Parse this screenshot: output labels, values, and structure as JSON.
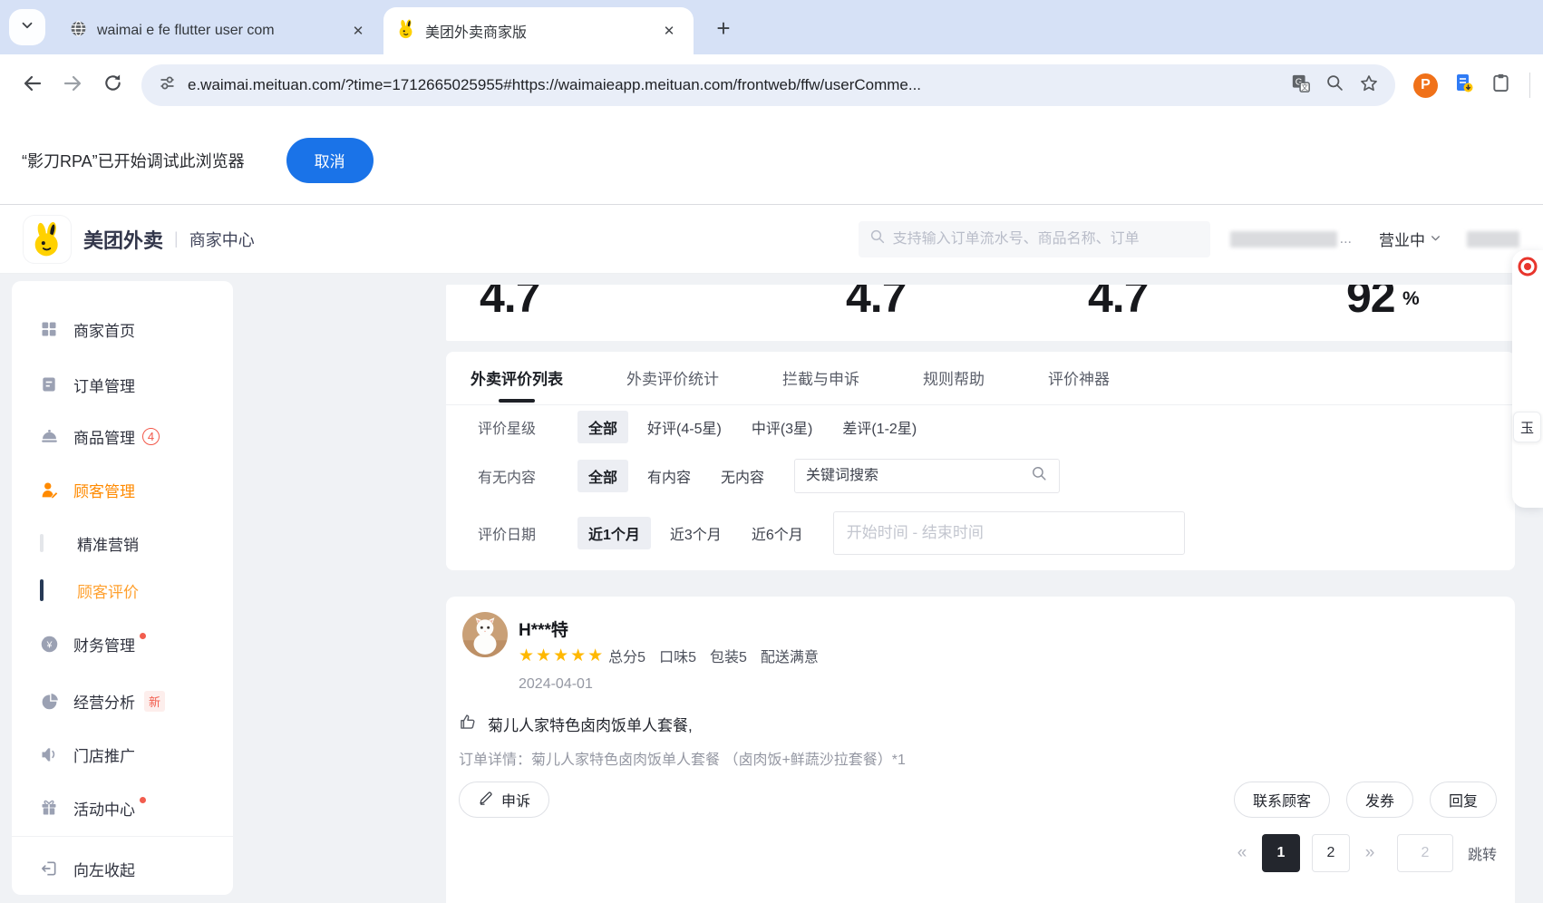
{
  "colors": {
    "accent_orange": "#FF8A00",
    "meituan_yellow": "#FFD100",
    "chrome_blue": "#1A73E8",
    "star_yellow": "#FFB800",
    "badge_red": "#F25D4E",
    "active_page_dark": "#23262D"
  },
  "browser": {
    "tabs": [
      {
        "title": "waimai e fe flutter user com"
      },
      {
        "title": "美团外卖商家版"
      }
    ],
    "close_glyph": "✕",
    "new_tab_glyph": "+",
    "url": "e.waimai.meituan.com/?time=1712665025955#https://waimaieapp.meituan.com/frontweb/ffw/userComme...",
    "ext_p_glyph": "P",
    "banner": {
      "text": "“影刀RPA”已开始调试此浏览器",
      "cancel_label": "取消"
    }
  },
  "header": {
    "brand": "美团外卖",
    "divider": "|",
    "portal": "商家中心",
    "search_placeholder": "支持输入订单流水号、商品名称、订单",
    "masked_ellipsis": "...",
    "status_label": "营业中"
  },
  "sidebar": {
    "items": [
      {
        "label": "商家首页"
      },
      {
        "label": "订单管理"
      },
      {
        "label": "商品管理",
        "badge": "4"
      },
      {
        "label": "顾客管理"
      },
      {
        "label": "精准营销"
      },
      {
        "label": "顾客评价"
      },
      {
        "label": "财务管理"
      },
      {
        "label": "经营分析",
        "new_badge": "新"
      },
      {
        "label": "门店推广"
      },
      {
        "label": "活动中心"
      }
    ],
    "collapse_label": "向左收起"
  },
  "stats": {
    "values": [
      "4.7",
      "4.7",
      "4.7",
      "92"
    ],
    "percent": "%"
  },
  "tabs": [
    {
      "label": "外卖评价列表"
    },
    {
      "label": "外卖评价统计"
    },
    {
      "label": "拦截与申诉"
    },
    {
      "label": "规则帮助"
    },
    {
      "label": "评价神器"
    }
  ],
  "filters": {
    "star_row": {
      "label": "评价星级",
      "options": [
        "全部",
        "好评(4-5星)",
        "中评(3星)",
        "差评(1-2星)"
      ]
    },
    "content_row": {
      "label": "有无内容",
      "options": [
        "全部",
        "有内容",
        "无内容"
      ],
      "search_placeholder": "关键词搜索"
    },
    "date_row": {
      "label": "评价日期",
      "options": [
        "近1个月",
        "近3个月",
        "近6个月"
      ],
      "range_placeholder": "开始时间 - 结束时间"
    }
  },
  "review": {
    "username": "H***特",
    "stars_glyphs": "★★★★★",
    "scores": [
      "总分5",
      "口味5",
      "包装5",
      "配送满意"
    ],
    "date": "2024-04-01",
    "content": "菊儿人家特色卤肉饭单人套餐,",
    "order_detail": "订单详情：菊儿人家特色卤肉饭单人套餐 （卤肉饭+鲜蔬沙拉套餐）*1",
    "appeal_label": "申诉",
    "actions": [
      {
        "label": "联系顾客"
      },
      {
        "label": "发券"
      },
      {
        "label": "回复"
      }
    ]
  },
  "pagination": {
    "prev_glyph": "«",
    "next_glyph": "»",
    "pages": [
      {
        "num": "1"
      },
      {
        "num": "2"
      }
    ],
    "jump_value": "2",
    "jump_label": "跳转"
  },
  "widget": {
    "label": "玉"
  }
}
